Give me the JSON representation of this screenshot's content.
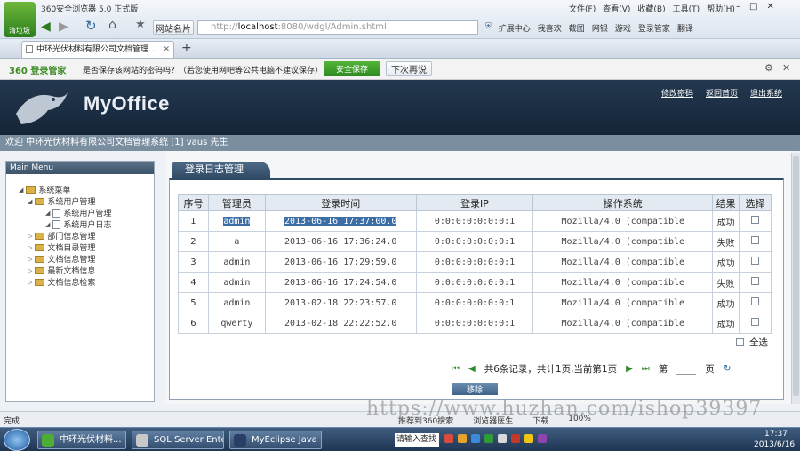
{
  "browser": {
    "title": "360安全浏览器 5.0 正式版",
    "menu": [
      "文件(F)",
      "查看(V)",
      "收藏(B)",
      "工具(T)",
      "帮助(H)"
    ],
    "logo_label": "清垃圾",
    "favorites_label": "网站名片",
    "url_prefix": "http://",
    "url_host": "localhost",
    "url_rest": ":8080/wdgl/Admin.shtml",
    "toolbar": [
      "扩展中心",
      "我喜欢",
      "截图",
      "网银",
      "游戏",
      "登录管家",
      "翻译"
    ],
    "tab_title": "中环光伏材料有限公司文档管理..."
  },
  "save_bar": {
    "brand": "360 登录管家",
    "question": "是否保存该网站的密码吗？（若您使用网吧等公共电脑不建议保存）",
    "save_button": "安全保存",
    "later_button": "下次再说"
  },
  "app": {
    "logo": "MyOffice",
    "nav_links": [
      "修改密码",
      "返回首页",
      "退出系统"
    ],
    "welcome": "欢迎 中环光伏材料有限公司文档管理系统 [1]  vaus 先生"
  },
  "sidebar": {
    "header": "Main Menu",
    "tree": [
      {
        "label": "系统菜单",
        "level": 0,
        "kind": "folder"
      },
      {
        "label": "系统用户管理",
        "level": 1,
        "kind": "folder"
      },
      {
        "label": "系统用户管理",
        "level": 2,
        "kind": "page"
      },
      {
        "label": "系统用户日志",
        "level": 2,
        "kind": "page"
      },
      {
        "label": "部门信息管理",
        "level": 1,
        "kind": "folder"
      },
      {
        "label": "文档目录管理",
        "level": 1,
        "kind": "folder"
      },
      {
        "label": "文档信息管理",
        "level": 1,
        "kind": "folder"
      },
      {
        "label": "最新文档信息",
        "level": 1,
        "kind": "folder"
      },
      {
        "label": "文档信息检索",
        "level": 1,
        "kind": "folder"
      }
    ]
  },
  "content": {
    "tab": "登录日志管理",
    "columns": [
      "序号",
      "管理员",
      "登录时间",
      "登录IP",
      "操作系统",
      "结果",
      "选择"
    ],
    "rows": [
      {
        "no": "1",
        "user": "admin",
        "time": "2013-06-16 17:37:00.0",
        "ip": "0:0:0:0:0:0:0:1",
        "os": "Mozilla/4.0 (compatible",
        "result": "成功"
      },
      {
        "no": "2",
        "user": "a",
        "time": "2013-06-16 17:36:24.0",
        "ip": "0:0:0:0:0:0:0:1",
        "os": "Mozilla/4.0 (compatible",
        "result": "失败"
      },
      {
        "no": "3",
        "user": "admin",
        "time": "2013-06-16 17:29:59.0",
        "ip": "0:0:0:0:0:0:0:1",
        "os": "Mozilla/4.0 (compatible",
        "result": "成功"
      },
      {
        "no": "4",
        "user": "admin",
        "time": "2013-06-16 17:24:54.0",
        "ip": "0:0:0:0:0:0:0:1",
        "os": "Mozilla/4.0 (compatible",
        "result": "失败"
      },
      {
        "no": "5",
        "user": "admin",
        "time": "2013-02-18 22:23:57.0",
        "ip": "0:0:0:0:0:0:0:1",
        "os": "Mozilla/4.0 (compatible",
        "result": "成功"
      },
      {
        "no": "6",
        "user": "qwerty",
        "time": "2013-02-18 22:22:52.0",
        "ip": "0:0:0:0:0:0:0:1",
        "os": "Mozilla/4.0 (compatible",
        "result": "成功"
      }
    ],
    "select_all": "全选",
    "pager_text": "共6条记录，共计1页,当前第1页",
    "page_prefix": "第",
    "page_suffix": "页",
    "delete_button": "移除"
  },
  "status": {
    "left": "完成",
    "items": [
      "推荐到360搜索",
      "浏览器医生",
      "下载",
      "100%"
    ]
  },
  "taskbar": {
    "tasks": [
      "中环光伏材料...",
      "SQL Server Ente...",
      "MyEclipse Java ..."
    ],
    "input_label": "请输入查找",
    "time": "17:37",
    "date": "2013/6/16"
  },
  "watermark": "https://www.huzhan.com/ishop39397",
  "colors": {
    "header": "#1d2f45",
    "accent": "#304b66",
    "selection": "#3a6ea5",
    "save_button": "#3b9a2c"
  }
}
